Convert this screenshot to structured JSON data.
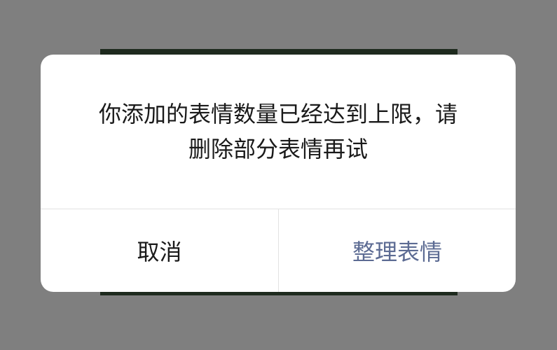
{
  "dialog": {
    "message_line1": "你添加的表情数量已经达到上限，请",
    "message_line2": "删除部分表情再试",
    "cancel_label": "取消",
    "confirm_label": "整理表情"
  },
  "colors": {
    "background_overlay": "#7f7f7f",
    "dialog_bg": "#ffffff",
    "text_primary": "#1a1a1a",
    "confirm_text": "#5c6b93",
    "divider": "#e2e2e2"
  }
}
